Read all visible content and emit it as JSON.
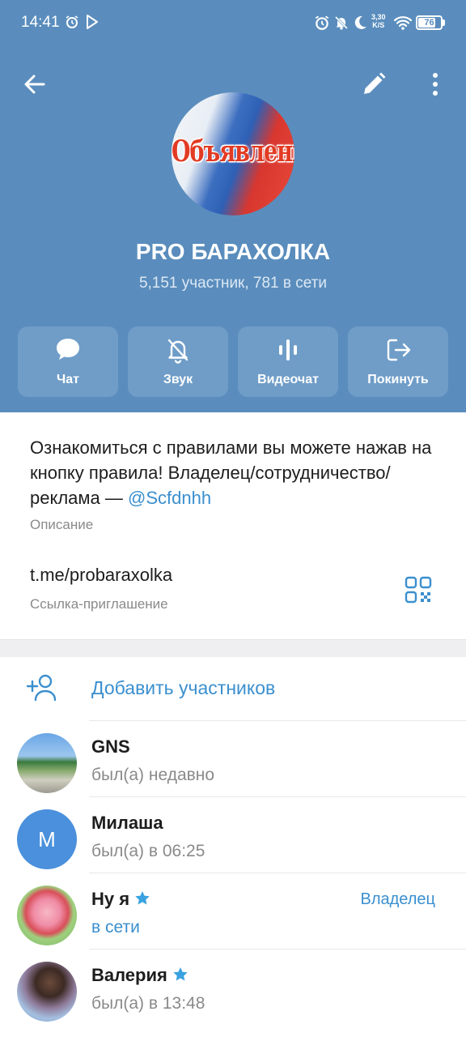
{
  "status_bar": {
    "time": "14:41",
    "net_speed_value": "3,30",
    "net_speed_unit": "K/S",
    "battery": "76",
    "battery_level": 0.76
  },
  "toolbar": {
    "back_icon": "arrow-left-icon",
    "edit_icon": "pencil-icon",
    "more_icon": "more-vertical-icon"
  },
  "group": {
    "avatar_text": "Объявления",
    "title": "PRO БАРАХОЛКА",
    "subtitle": "5,151 участник, 781 в сети"
  },
  "actions": [
    {
      "label": "Чат",
      "icon": "chat-bubble-icon"
    },
    {
      "label": "Звук",
      "icon": "bell-muted-icon"
    },
    {
      "label": "Видеочат",
      "icon": "voice-bars-icon"
    },
    {
      "label": "Покинуть",
      "icon": "leave-icon"
    }
  ],
  "info": {
    "description_text": "Ознакомиться с правилами вы можете нажав на кнопку правила! Владелец/сотрудничество/реклама — ",
    "description_mention": "@Scfdnhh",
    "description_label": "Описание",
    "invite_link": "t.me/probaraxolka",
    "invite_label": "Ссылка-приглашение"
  },
  "members": {
    "add_label": "Добавить участников",
    "list": [
      {
        "name": "GNS",
        "status": "был(а) недавно",
        "avatar_letter": "",
        "role": ""
      },
      {
        "name": "Милаша",
        "status": "был(а) в 06:25",
        "avatar_letter": "М",
        "role": ""
      },
      {
        "name": "Ну я",
        "status": "в сети",
        "avatar_letter": "",
        "role": "Владелец"
      },
      {
        "name": "Валерия",
        "status": "был(а) в 13:48",
        "avatar_letter": "",
        "role": ""
      }
    ]
  },
  "colors": {
    "header_bg": "#5a8dbd",
    "action_btn_bg": "#6f9dc8",
    "accent": "#3a8fcf"
  }
}
